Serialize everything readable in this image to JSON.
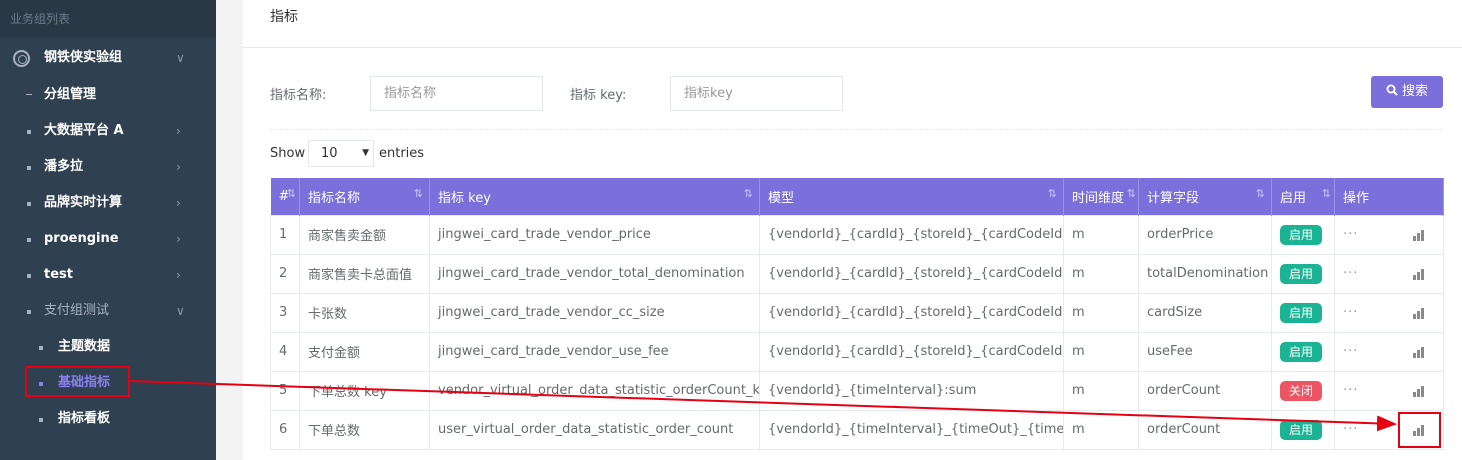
{
  "sidebar": {
    "header": "业务组列表",
    "group": "钢铁侠实验组",
    "items": [
      {
        "label": "分组管理"
      },
      {
        "label": "大数据平台 A"
      },
      {
        "label": "潘多拉"
      },
      {
        "label": "品牌实时计算"
      },
      {
        "label": "proengine"
      },
      {
        "label": "test"
      },
      {
        "label": "支付组测试"
      }
    ],
    "subitems": [
      {
        "label": "主题数据"
      },
      {
        "label": "基础指标"
      },
      {
        "label": "指标看板"
      }
    ]
  },
  "panel": {
    "title": "指标",
    "filters": {
      "name_label": "指标名称:",
      "name_placeholder": "指标名称",
      "key_label": "指标 key:",
      "key_placeholder": "指标key"
    },
    "search_label": "搜索",
    "show_label": "Show",
    "page_size": "10",
    "entries_label": "entries"
  },
  "table": {
    "headers": [
      "#",
      "指标名称",
      "指标 key",
      "模型",
      "时间维度",
      "计算字段",
      "启用",
      "操作"
    ],
    "rows": [
      {
        "no": "1",
        "name": "商家售卖金额",
        "key": "jingwei_card_trade_vendor_price",
        "model": "{vendorId}_{cardId}_{storeId}_{cardCodeId}:sum",
        "time": "m",
        "field": "orderPrice",
        "status": "启用",
        "more": "···"
      },
      {
        "no": "2",
        "name": "商家售卖卡总面值",
        "key": "jingwei_card_trade_vendor_total_denomination",
        "model": "{vendorId}_{cardId}_{storeId}_{cardCodeId}:sum",
        "time": "m",
        "field": "totalDenomination",
        "status": "启用",
        "more": "···"
      },
      {
        "no": "3",
        "name": "卡张数",
        "key": "jingwei_card_trade_vendor_cc_size",
        "model": "{vendorId}_{cardId}_{storeId}_{cardCodeId}:sum",
        "time": "m",
        "field": "cardSize",
        "status": "启用",
        "more": "···"
      },
      {
        "no": "4",
        "name": "支付金额",
        "key": "jingwei_card_trade_vendor_use_fee",
        "model": "{vendorId}_{cardId}_{storeId}_{cardCodeId}:sum",
        "time": "m",
        "field": "useFee",
        "status": "启用",
        "more": "···"
      },
      {
        "no": "5",
        "name": "下单总数 key",
        "key": "vendor_virtual_order_data_statistic_orderCount_key",
        "model": "{vendorId}_{timeInterval}:sum",
        "time": "m",
        "field": "orderCount",
        "status": "关闭",
        "more": "···"
      },
      {
        "no": "6",
        "name": "下单总数",
        "key": "user_virtual_order_data_statistic_order_count",
        "model": "{vendorId}_{timeInterval}_{timeOut}_{time}:sum",
        "time": "m",
        "field": "orderCount",
        "status": "启用",
        "more": "···"
      }
    ]
  },
  "colors": {
    "accent": "#7a6fdb",
    "sidebar_bg": "#2f4050",
    "enabled": "#1ab394",
    "disabled": "#ed5565",
    "annotation": "#e60012"
  },
  "icons": {
    "group": "lifebuoy-icon",
    "search": "search-icon",
    "chart": "bar-chart-icon",
    "chevron": "chevron-icon"
  }
}
